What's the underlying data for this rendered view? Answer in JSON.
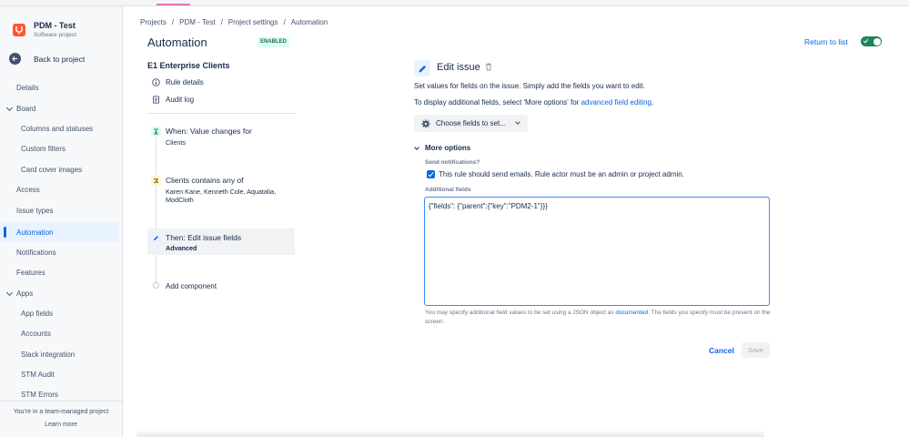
{
  "project": {
    "name": "PDM - Test",
    "type": "Software project"
  },
  "sidebar": {
    "back_label": "Back to project",
    "items": [
      {
        "label": "Details"
      },
      {
        "label": "Board"
      },
      {
        "label": "Columns and statuses"
      },
      {
        "label": "Custom filters"
      },
      {
        "label": "Card cover images"
      },
      {
        "label": "Access"
      },
      {
        "label": "Issue types"
      },
      {
        "label": "Automation"
      },
      {
        "label": "Notifications"
      },
      {
        "label": "Features"
      },
      {
        "label": "Apps"
      },
      {
        "label": "App fields"
      },
      {
        "label": "Accounts"
      },
      {
        "label": "Slack integration"
      },
      {
        "label": "STM Audit"
      },
      {
        "label": "STM Errors"
      }
    ],
    "selected": "Automation",
    "footer": {
      "text": "You're in a team-managed project",
      "link": "Learn more"
    }
  },
  "breadcrumb": [
    "Projects",
    "/",
    "PDM - Test",
    "/",
    "Project settings",
    "/",
    "Automation"
  ],
  "header": {
    "title": "Automation",
    "status": "ENABLED",
    "return_label": "Return to list",
    "enabled": true
  },
  "rule": {
    "name": "E1 Enterprise Clients",
    "links": [
      {
        "label": "Rule details"
      },
      {
        "label": "Audit log"
      }
    ],
    "steps": [
      {
        "title": "When: Value changes for",
        "detail": "Clients",
        "color": "#dcfff1"
      },
      {
        "title": "Clients contains any of",
        "detail": "Karen Kane, Kenneth Cole, Aquatalia,",
        "detail2": "ModCloth",
        "color": "#fff7d6"
      },
      {
        "title": "Then: Edit issue fields",
        "detail": "Advanced",
        "color": "#e9f2ff"
      }
    ],
    "add_component": "Add component"
  },
  "editor": {
    "title": "Edit issue",
    "desc1": "Set values for fields on the issue. Simply add the fields you want to edit.",
    "desc2_prefix": "To display additional fields, select 'More options' for ",
    "desc2_link": "advanced field editing",
    "desc2_suffix": ".",
    "choose_label": "Choose fields to set...",
    "more_options": "More options",
    "notify_label": "Send notifications?",
    "notify_text": "This rule should send emails. Rule actor must be an admin or project admin.",
    "additional_label": "Additional fields",
    "additional_value": "{\"fields\": {\"parent\":{\"key\":\"PDM2-1\"}}}",
    "help_prefix": "You may specify additional field values to be set using a JSON object as ",
    "help_link": "documented",
    "help_suffix": ". The fields you specify must be present on the screen.",
    "cancel": "Cancel",
    "save": "Save"
  },
  "colors": {
    "accent": "#0c66e4",
    "enabled": "#1f845a",
    "selected_bg": "#e9f2ff"
  }
}
